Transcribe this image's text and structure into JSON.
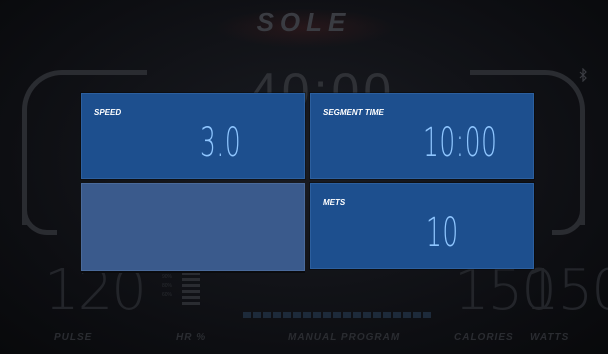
{
  "brand": {
    "logo": "SOLE",
    "sub": ""
  },
  "background": {
    "time": "40:00",
    "pulse": {
      "value": "120",
      "label": "PULSE"
    },
    "hr": {
      "label": "HR %",
      "pcts": [
        "90%",
        "80%",
        "60%"
      ]
    },
    "program": {
      "label": "MANUAL PROGRAM"
    },
    "calories": {
      "value": "150",
      "label": "CALORIES"
    },
    "watts": {
      "value": "150",
      "label": "WATTS"
    }
  },
  "panels": {
    "speed": {
      "label": "SPEED",
      "value": "3.0"
    },
    "segment_time": {
      "label": "SEGMENT TIME",
      "value": "10:00"
    },
    "mets": {
      "label": "METS",
      "value": "10"
    }
  },
  "icons": {
    "bluetooth": "bluetooth-icon"
  },
  "colors": {
    "panel": "#1d4f8e",
    "panel_empty": "#3a5a8c",
    "value": "#8fc6ff"
  }
}
